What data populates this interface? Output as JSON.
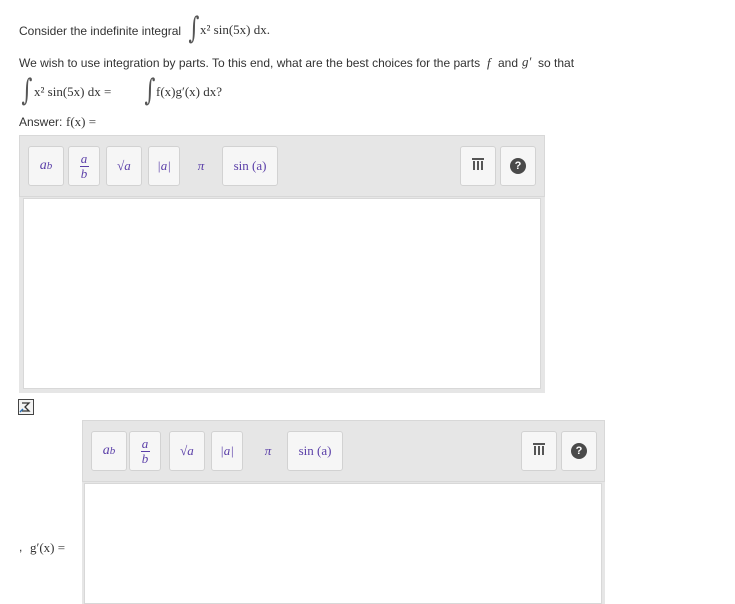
{
  "question": {
    "intro_text": "Consider the indefinite integral",
    "integrand": "x² sin(5x) dx.",
    "parts_text": "We wish to use integration by parts. To this end, what are the best choices for the parts",
    "f_symbol": "f",
    "and_text": "and",
    "g_prime_symbol": "g′",
    "so_that_text": "so that",
    "equation_left": "x² sin(5x) dx =",
    "equation_right": "f(x)g′(x) dx?"
  },
  "answer": {
    "label": "Answer:",
    "f_label": "f(x) =",
    "g_label": "g′(x) =",
    "separator": ","
  },
  "toolbar": {
    "power": "a",
    "power_sup": "b",
    "frac_num": "a",
    "frac_den": "b",
    "sqrt": "√a",
    "abs": "|a|",
    "pi": "π",
    "sin": "sin (a)",
    "help": "?"
  }
}
